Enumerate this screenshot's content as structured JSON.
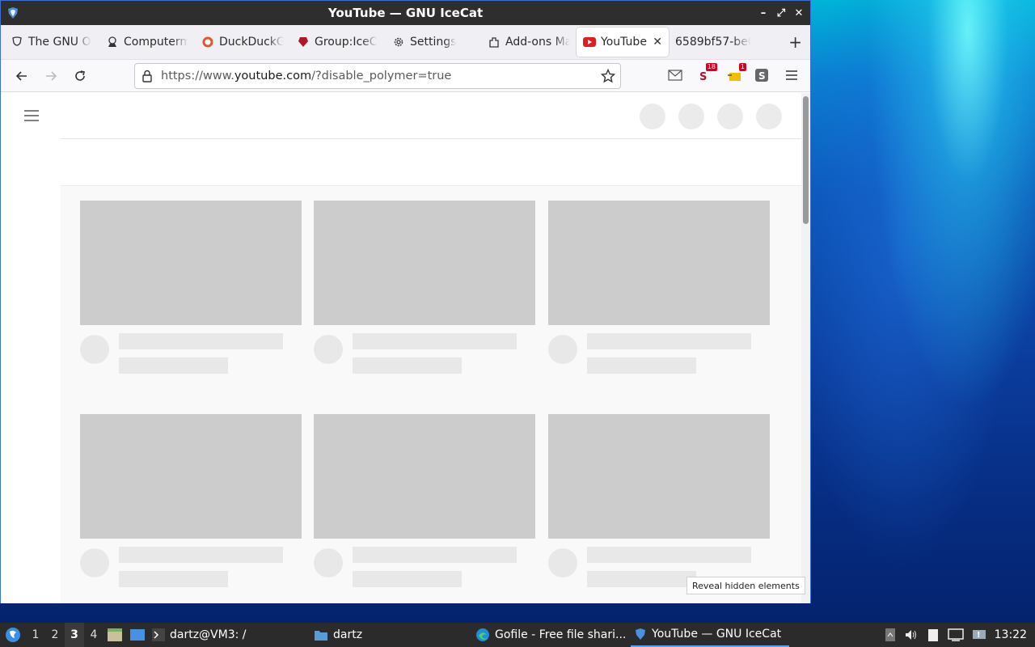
{
  "window": {
    "title": "YouTube — GNU IceCat"
  },
  "tabs": [
    {
      "label": "The GNU O",
      "icon": "gnu-icon"
    },
    {
      "label": "Computerm",
      "icon": "computer-icon"
    },
    {
      "label": "DuckDuckG",
      "icon": "duckduckgo-icon"
    },
    {
      "label": "Group:IceC",
      "icon": "group-icon"
    },
    {
      "label": "Settings",
      "icon": "gear-icon"
    },
    {
      "label": "Add-ons Ma",
      "icon": "puzzle-icon"
    },
    {
      "label": "YouTube",
      "icon": "youtube-icon",
      "active": true
    },
    {
      "label": "6589bf57-be0",
      "icon": "none"
    }
  ],
  "navbar": {
    "url_prefix": "https://www.",
    "url_domain": "youtube.com",
    "url_suffix": "/?disable_polymer=true",
    "ext_badge_1": "18",
    "ext_badge_2": "1"
  },
  "content": {
    "reveal_label": "Reveal hidden elements"
  },
  "taskbar": {
    "workspaces": [
      "1",
      "2",
      "3",
      "4"
    ],
    "tasks": [
      {
        "label": "dartz@VM3: /",
        "icon": "terminal-icon"
      },
      {
        "label": "dartz",
        "icon": "folder-icon"
      },
      {
        "label": "Gofile - Free file shari...",
        "icon": "edge-icon"
      },
      {
        "label": "YouTube — GNU IceCat",
        "icon": "icecat-icon"
      }
    ],
    "clock": "13:22"
  }
}
